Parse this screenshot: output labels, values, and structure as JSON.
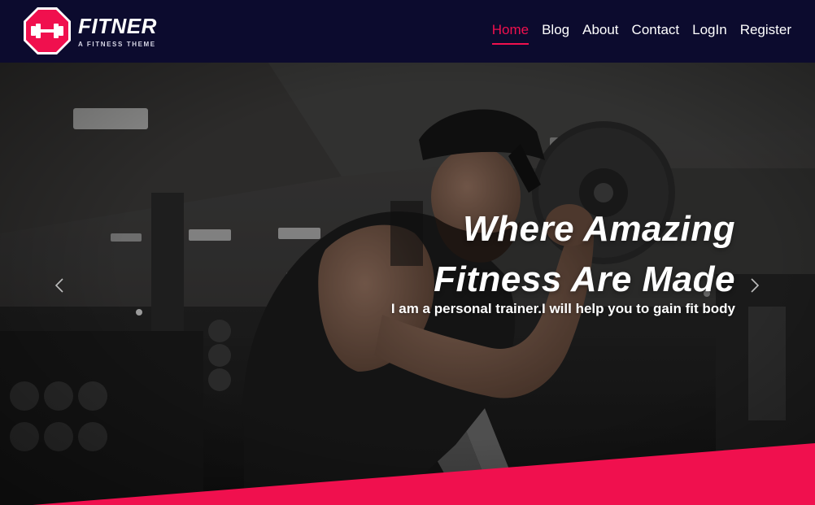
{
  "brand": {
    "name": "FITNER",
    "tagline": "A FITNESS THEME"
  },
  "nav": {
    "items": [
      {
        "label": "Home",
        "active": true
      },
      {
        "label": "Blog",
        "active": false
      },
      {
        "label": "About",
        "active": false
      },
      {
        "label": "Contact",
        "active": false
      },
      {
        "label": "LogIn",
        "active": false
      },
      {
        "label": "Register",
        "active": false
      }
    ]
  },
  "hero": {
    "title_line1": "Where Amazing",
    "title_line2": "Fitness Are Made",
    "subtitle": "I am a personal trainer.I will help you to gain fit body",
    "prev_icon": "chevron-left-icon",
    "next_icon": "chevron-right-icon"
  },
  "colors": {
    "header_bg": "#0c0b2e",
    "accent": "#f0104e",
    "text": "#ffffff"
  }
}
